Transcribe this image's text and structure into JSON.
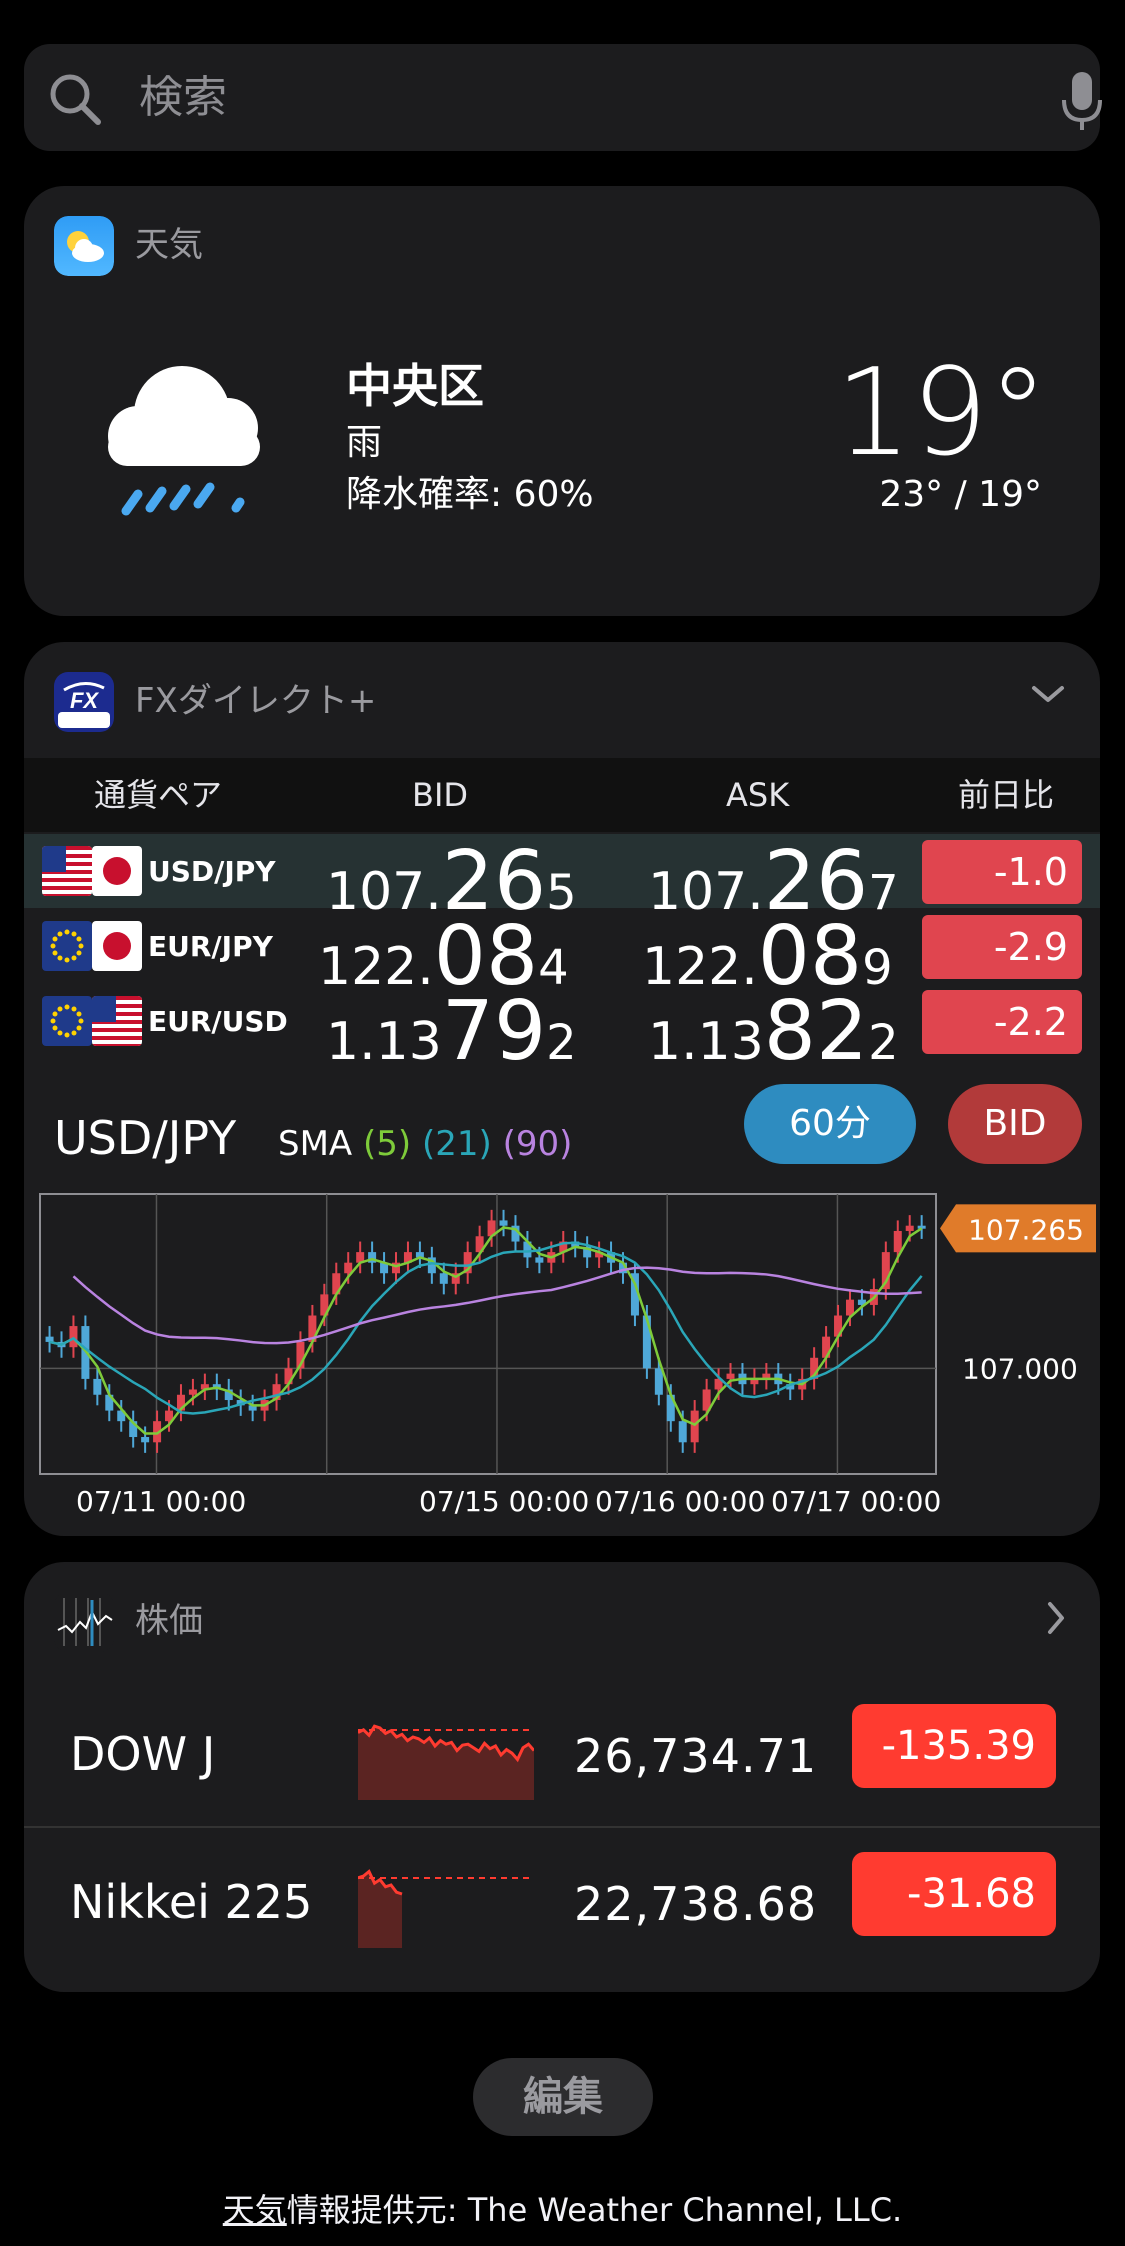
{
  "search": {
    "placeholder": "検索",
    "icon": "magnifying-glass-icon",
    "mic_icon": "microphone-icon"
  },
  "weather": {
    "app_name": "天気",
    "app_icon": "weather-app-icon",
    "condition_icon": "rain-cloud-icon",
    "city": "中央区",
    "condition": "雨",
    "precipitation": "降水確率: 60%",
    "temperature": "19°",
    "high_low": "23° / 19°"
  },
  "fx": {
    "app_name": "FXダイレクト+",
    "app_icon": "fx-direct-app-icon",
    "columns": [
      "通貨ペア",
      "BID",
      "ASK",
      "前日比"
    ],
    "rows": [
      {
        "pair": "USD/JPY",
        "flags": [
          "us-flag-icon",
          "jp-flag-icon"
        ],
        "bid": {
          "a": "107.",
          "b": "26",
          "c": "5"
        },
        "ask": {
          "a": "107.",
          "b": "26",
          "c": "7"
        },
        "change": "-1.0",
        "selected": true
      },
      {
        "pair": "EUR/JPY",
        "flags": [
          "eu-flag-icon",
          "jp-flag-icon"
        ],
        "bid": {
          "a": "122.",
          "b": "08",
          "c": "4"
        },
        "ask": {
          "a": "122.",
          "b": "08",
          "c": "9"
        },
        "change": "-2.9",
        "selected": false
      },
      {
        "pair": "EUR/USD",
        "flags": [
          "eu-flag-icon",
          "us-flag-icon"
        ],
        "bid": {
          "a": "1.13",
          "b": "79",
          "c": "2"
        },
        "ask": {
          "a": "1.13",
          "b": "82",
          "c": "2"
        },
        "change": "-2.2",
        "selected": false
      }
    ],
    "chart_symbol": "USD/JPY",
    "sma_label": "SMA",
    "sma_periods": [
      "(5)",
      "(21)",
      "(90)"
    ],
    "interval_button": "60分",
    "price_type_button": "BID",
    "colors": {
      "up": "#e0454f",
      "down": "#4fa8d8",
      "sma5": "#7ecb3a",
      "sma21": "#2aa6b8",
      "sma90": "#b983e0",
      "price_tag": "#e07b2a",
      "interval": "#2e8cc0",
      "bid": "#b23a3a"
    }
  },
  "chart_data": {
    "type": "candlestick",
    "title": "USD/JPY",
    "ylim": [
      106.8,
      107.33
    ],
    "current_price": "107.265",
    "reference_level": "107.000",
    "x_ticks": [
      "07/11 00:00",
      "07/15 00:00",
      "07/16 00:00",
      "07/17 00:00"
    ],
    "close": [
      107.05,
      107.04,
      107.08,
      106.98,
      106.95,
      106.92,
      106.9,
      106.87,
      106.86,
      106.9,
      106.92,
      106.95,
      106.96,
      106.97,
      106.96,
      106.94,
      106.93,
      106.92,
      106.94,
      106.97,
      107.0,
      107.05,
      107.1,
      107.14,
      107.18,
      107.2,
      107.22,
      107.2,
      107.18,
      107.2,
      107.22,
      107.21,
      107.18,
      107.16,
      107.18,
      107.22,
      107.25,
      107.28,
      107.27,
      107.24,
      107.21,
      107.2,
      107.22,
      107.24,
      107.23,
      107.21,
      107.22,
      107.2,
      107.18,
      107.1,
      107.0,
      106.95,
      106.9,
      106.86,
      106.92,
      106.96,
      106.98,
      106.99,
      106.97,
      106.98,
      106.99,
      106.97,
      106.96,
      106.98,
      107.02,
      107.06,
      107.1,
      107.13,
      107.12,
      107.15,
      107.22,
      107.26,
      107.27,
      107.265
    ],
    "sma90_label": "(90)"
  },
  "stocks": {
    "app_name": "株価",
    "app_icon": "stocks-app-icon",
    "chevron": "chevron-right-icon",
    "items": [
      {
        "name": "DOW J",
        "price": "26,734.71",
        "change": "-135.39",
        "spark": [
          0.75,
          0.78,
          0.72,
          0.82,
          0.8,
          0.74,
          0.77,
          0.7,
          0.73,
          0.66,
          0.7,
          0.68,
          0.64,
          0.69,
          0.6,
          0.66,
          0.62,
          0.64,
          0.55,
          0.61,
          0.62,
          0.58,
          0.54,
          0.63,
          0.57,
          0.6,
          0.5,
          0.56,
          0.52,
          0.45,
          0.58,
          0.62,
          0.55
        ]
      },
      {
        "name": "Nikkei 225",
        "price": "22,738.68",
        "change": "-31.68",
        "spark": [
          0.78,
          0.8,
          0.85,
          0.72,
          0.76,
          0.68,
          0.7,
          0.62,
          0.6
        ]
      }
    ]
  },
  "edit_button": "編集",
  "footer": {
    "prefix": "天気",
    "text": "情報提供元: The Weather Channel, LLC."
  }
}
